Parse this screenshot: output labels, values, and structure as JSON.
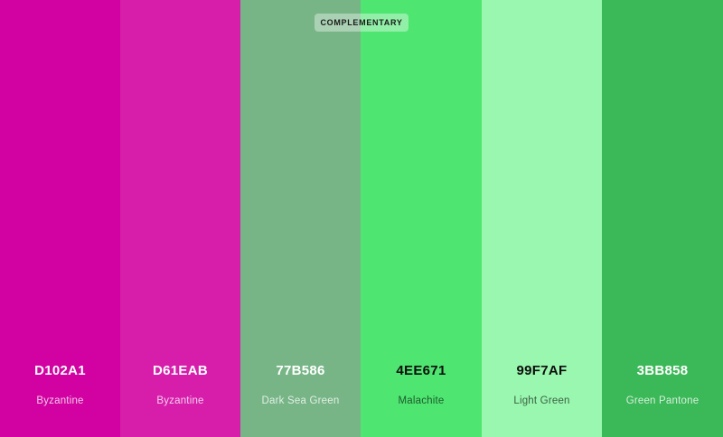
{
  "badge": {
    "label": "COMPLEMENTARY"
  },
  "swatches": [
    {
      "hex": "D102A1",
      "name": "Byzantine",
      "color": "#D102A1"
    },
    {
      "hex": "D61EAB",
      "name": "Byzantine",
      "color": "#D61EAB"
    },
    {
      "hex": "77B586",
      "name": "Dark Sea Green",
      "color": "#77B586"
    },
    {
      "hex": "4EE671",
      "name": "Malachite",
      "color": "#4EE671"
    },
    {
      "hex": "99F7AF",
      "name": "Light Green",
      "color": "#99F7AF"
    },
    {
      "hex": "3BB858",
      "name": "Green Pantone",
      "color": "#3BB858"
    }
  ]
}
